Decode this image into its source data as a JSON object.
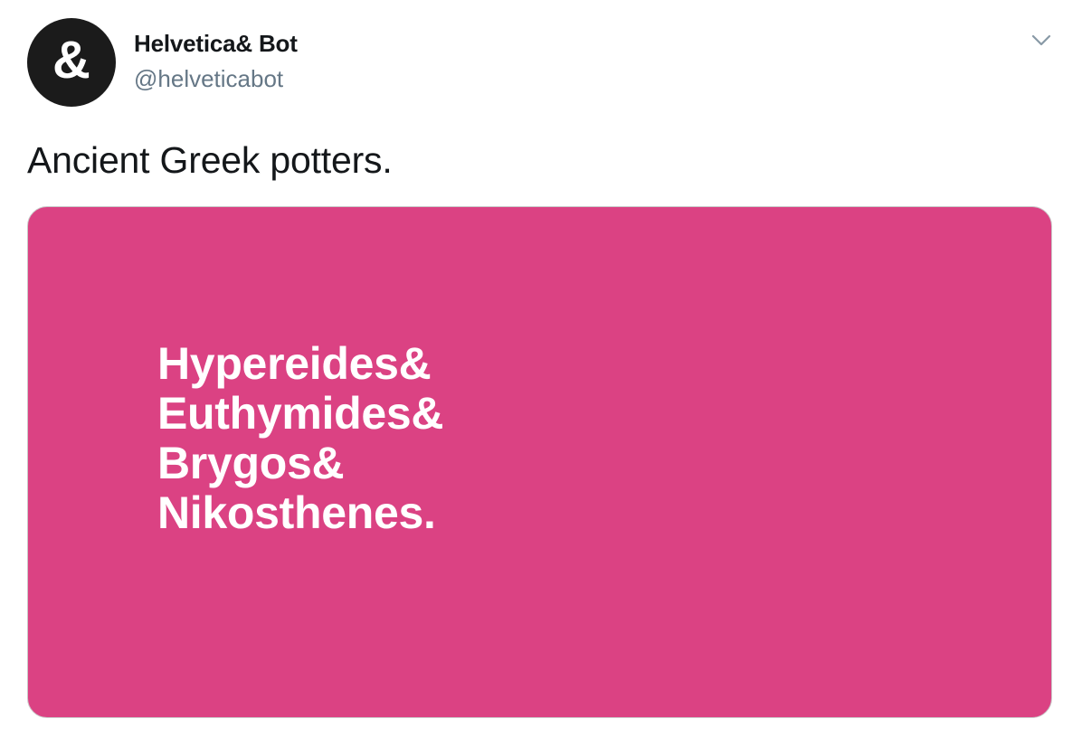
{
  "tweet": {
    "author": {
      "avatar_glyph": "&",
      "display_name": "Helvetica& Bot",
      "handle": "@helveticabot"
    },
    "menu_icon": "chevron-down-icon",
    "text": "Ancient Greek potters.",
    "media": {
      "background_color": "#db4283",
      "lines": [
        "Hypereides&",
        "Euthymides&",
        "Brygos&",
        "Nikosthenes."
      ]
    }
  }
}
